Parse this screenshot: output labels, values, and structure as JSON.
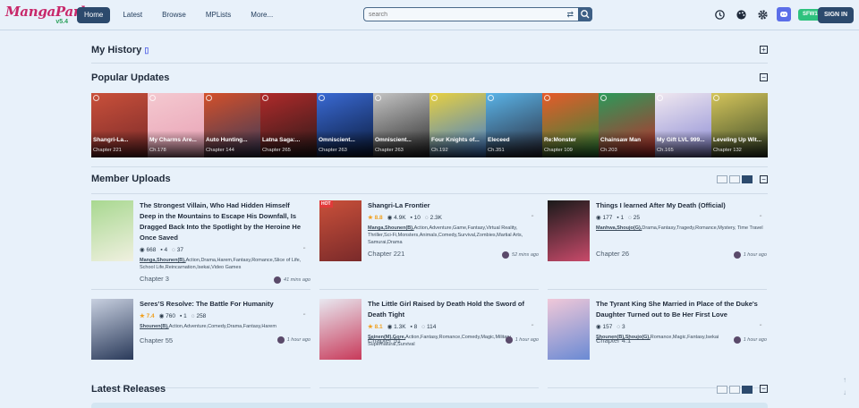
{
  "header": {
    "logo_text": "MangaPark",
    "version": "v5.4",
    "nav": [
      "Home",
      "Latest",
      "Browse",
      "MPLists",
      "More..."
    ],
    "search_placeholder": "search",
    "sfw_badge": "SFW1",
    "signin_label": "SIGN IN",
    "icons": [
      "history-icon",
      "palette-icon",
      "gear-icon",
      "discord-icon",
      "shuffle-icon",
      "search-icon"
    ]
  },
  "history": {
    "title": "My History",
    "toggle": "+"
  },
  "popular": {
    "title": "Popular Updates",
    "toggle": "−",
    "items": [
      {
        "title": "Shangri-La...",
        "chapter": "Chapter 221",
        "c1": "#c9503a",
        "c2": "#7a2a2a"
      },
      {
        "title": "My Charms Are...",
        "chapter": "Ch.178",
        "c1": "#f4c9d0",
        "c2": "#e8a0b4"
      },
      {
        "title": "Auto Hunting...",
        "chapter": "Chapter 144",
        "c1": "#d4502a",
        "c2": "#3a3a5a"
      },
      {
        "title": "Latna Saga:...",
        "chapter": "Chapter 265",
        "c1": "#b02a2a",
        "c2": "#2a1a1a"
      },
      {
        "title": "Omniscient...",
        "chapter": "Chapter 263",
        "c1": "#3a6ad4",
        "c2": "#0a1a3a"
      },
      {
        "title": "Omniscient...",
        "chapter": "Chapter 263",
        "c1": "#c4c4c4",
        "c2": "#2a2a2a"
      },
      {
        "title": "Four Knights of...",
        "chapter": "Ch.192",
        "c1": "#e8d040",
        "c2": "#3a7ad4"
      },
      {
        "title": "Eleceed",
        "chapter": "Ch.351",
        "c1": "#5ab4e8",
        "c2": "#2a2a3a"
      },
      {
        "title": "Re:Monster",
        "chapter": "Chapter 109",
        "c1": "#e85a2a",
        "c2": "#2a8a3a"
      },
      {
        "title": "Chainsaw Man",
        "chapter": "Ch.203",
        "c1": "#2a9a5a",
        "c2": "#c42a2a"
      },
      {
        "title": "My Gift LVL 999...",
        "chapter": "Ch.165",
        "c1": "#f0e8f0",
        "c2": "#8a8ad4"
      },
      {
        "title": "Leveling Up Wit...",
        "chapter": "Chapter 132",
        "c1": "#d4c45a",
        "c2": "#3a4a2a"
      }
    ]
  },
  "member": {
    "title": "Member Uploads",
    "toggle": "−",
    "items": [
      {
        "title": "The Strongest Villain, Who Had Hidden Himself Deep in the Mountains to Escape His Downfall, Is Dragged Back Into the Spotlight by the Heroine He Once Saved",
        "rating": "",
        "views": "668",
        "comments": "4",
        "replies": "37",
        "tags_bold": "Manga,Shounen(B),",
        "tags": "Action,Drama,Harem,Fantasy,Romance,Slice of Life, School Life,Reincarnation,Isekai,Video Games",
        "chapter": "Chapter 3",
        "time": "41 mins ago",
        "c1": "#a8d890",
        "c2": "#f0f0e0"
      },
      {
        "title": "Shangri-La Frontier",
        "rating": "8.8",
        "views": "4.9K",
        "comments": "10",
        "replies": "2.3K",
        "tags_bold": "Manga,Shounen(B),",
        "tags": "Action,Adventure,Game,Fantasy,Virtual Reality, Thriller,Sci-Fi,Monsters,Animals,Comedy,Survival,Zombies,Martial Arts, Samurai,Drama",
        "chapter": "Chapter 221",
        "time": "52 mins ago",
        "c1": "#c9503a",
        "c2": "#7a2a2a"
      },
      {
        "title": "Things I learned After My Death (Official)",
        "rating": "",
        "views": "177",
        "comments": "1",
        "replies": "25",
        "tags_bold": "Manhwa,Shoujo(G),",
        "tags": "Drama,Fantasy,Tragedy,Romance,Mystery, Time Travel",
        "chapter": "Chapter 26",
        "time": "1 hour ago",
        "c1": "#1a1a1a",
        "c2": "#c84a6a"
      },
      {
        "title": "Seres’S Resolve: The Battle For Humanity",
        "rating": "7.4",
        "views": "760",
        "comments": "1",
        "replies": "258",
        "tags_bold": "Shounen(B),",
        "tags": "Action,Adventure,Comedy,Drama,Fantasy,Harem",
        "chapter": "Chapter 55",
        "time": "1 hour ago",
        "c1": "#c8d0e0",
        "c2": "#2a3a5a"
      },
      {
        "title": "The Little Girl Raised by Death Hold the Sword of Death Tight",
        "rating": "8.1",
        "views": "1.3K",
        "comments": "8",
        "replies": "114",
        "tags_bold": "Seinen(M),Gore,",
        "tags": "Action,Fantasy,Romance,Comedy,Magic,Military, Supernatural,Survival",
        "chapter": "Chapter 51",
        "time": "1 hour ago",
        "c1": "#e8e8f0",
        "c2": "#c83a5a"
      },
      {
        "title": "The Tyrant King She Married in Place of the Duke's Daughter Turned out to Be Her First Love",
        "rating": "",
        "views": "157",
        "comments": "",
        "replies": "3",
        "tags_bold": "Shounen(B),Shoujo(G),",
        "tags": "Romance,Magic,Fantasy,Isekai",
        "chapter": "Chapter 4.1",
        "time": "1 hour ago",
        "c1": "#f0c8d8",
        "c2": "#6a8ad4"
      }
    ]
  },
  "latest": {
    "title": "Latest Releases",
    "toggle": "−"
  }
}
